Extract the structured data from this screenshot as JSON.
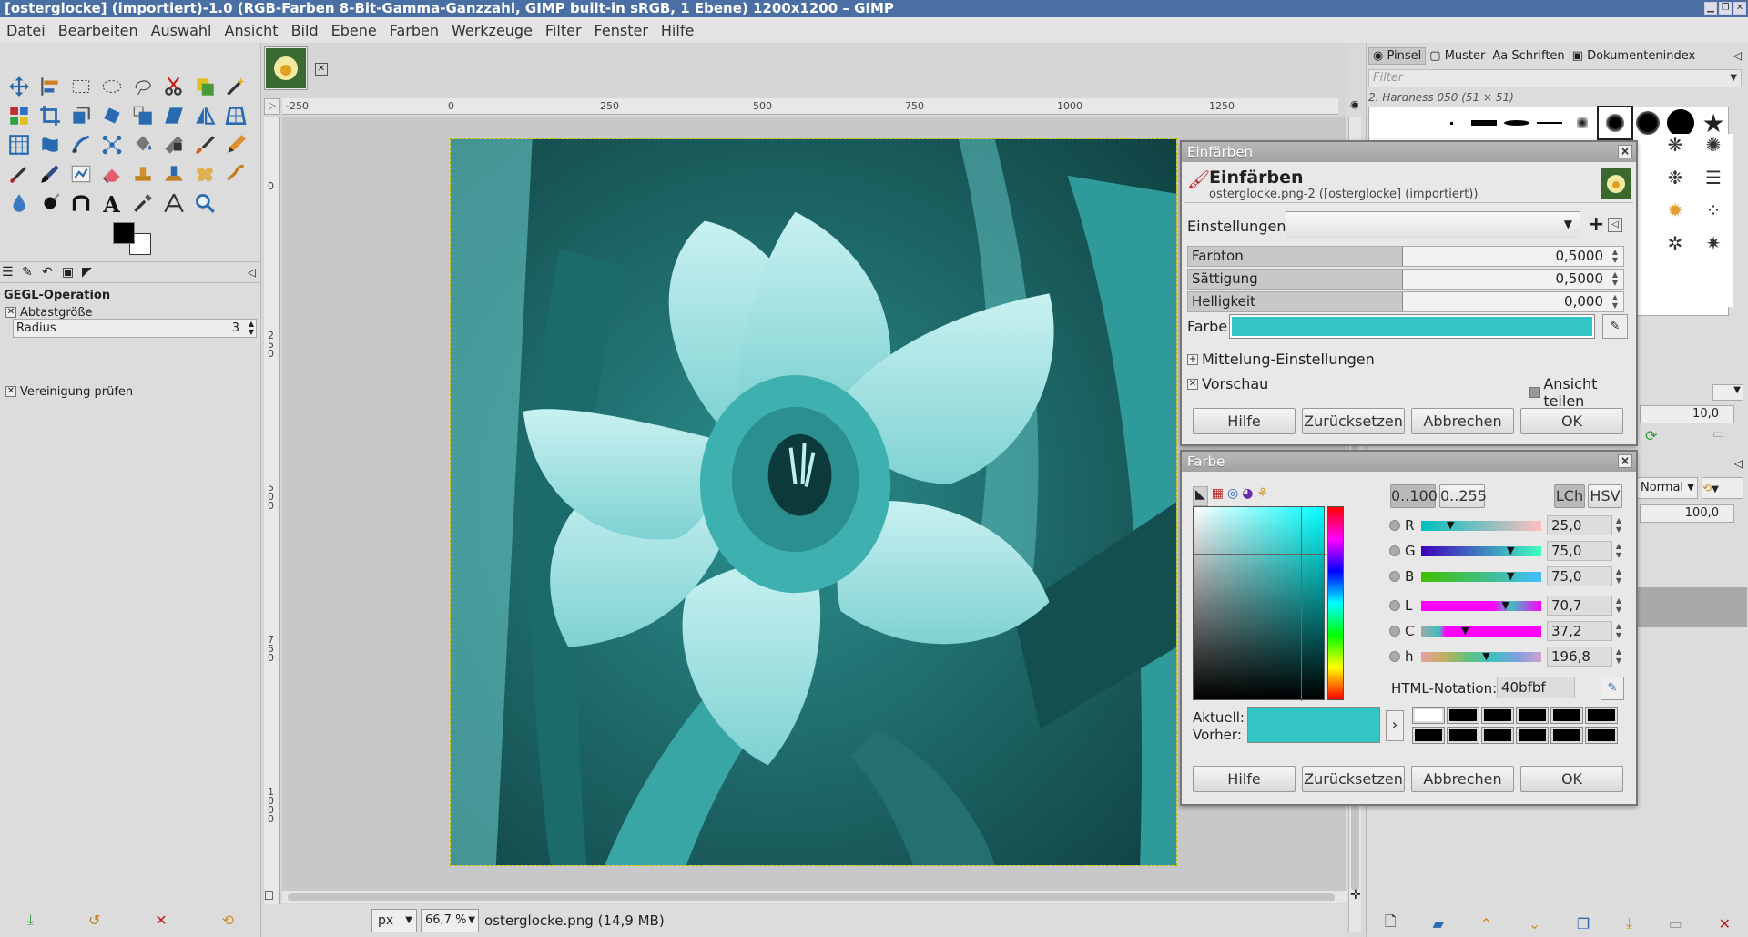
{
  "window": {
    "title": "[osterglocke] (importiert)-1.0 (RGB-Farben 8-Bit-Gamma-Ganzzahl, GIMP built-in sRGB, 1 Ebene) 1200x1200 – GIMP"
  },
  "menu": [
    "Datei",
    "Bearbeiten",
    "Auswahl",
    "Ansicht",
    "Bild",
    "Ebene",
    "Farben",
    "Werkzeuge",
    "Filter",
    "Fenster",
    "Hilfe"
  ],
  "tool_options": {
    "title": "GEGL-Operation",
    "sample_size_label": "Abtastgröße",
    "radius_label": "Radius",
    "radius_value": "3",
    "merge_label": "Vereinigung prüfen"
  },
  "ruler": {
    "h": [
      "-250",
      "0",
      "250",
      "500",
      "750",
      "1000",
      "1250"
    ],
    "v": [
      "0",
      "2 5 0",
      "5 0 0",
      "7 5 0",
      "1 0 0 0"
    ]
  },
  "status": {
    "unit": "px",
    "zoom": "66,7 %",
    "file": "osterglocke.png (14,9 MB)"
  },
  "brushes": {
    "tabs": [
      "Pinsel",
      "Muster",
      "Schriften",
      "Dokumentenindex"
    ],
    "filter_placeholder": "Filter",
    "current": "2. Hardness 050 (51 × 51)",
    "spacing": "10,0"
  },
  "layers": {
    "mode": "Normal",
    "opacity": "100,0"
  },
  "colorize": {
    "window_title": "Einfärben",
    "heading": "Einfärben",
    "subtitle": "osterglocke.png-2 ([osterglocke] (importiert))",
    "settings_label": "Einstellungen:",
    "hue_label": "Farbton",
    "hue_value": "0,5000",
    "sat_label": "Sättigung",
    "sat_value": "0,5000",
    "light_label": "Helligkeit",
    "light_value": "0,000",
    "color_label": "Farbe",
    "blending_label": "Mittelung-Einstellungen",
    "preview_label": "Vorschau",
    "split_label": "Ansicht teilen",
    "help": "Hilfe",
    "reset": "Zurücksetzen",
    "cancel": "Abbrechen",
    "ok": "OK"
  },
  "color_dialog": {
    "window_title": "Farbe",
    "range1": "0..100",
    "range2": "0..255",
    "lch": "LCh",
    "hsv": "HSV",
    "channels": [
      {
        "label": "R",
        "value": "25,0"
      },
      {
        "label": "G",
        "value": "75,0"
      },
      {
        "label": "B",
        "value": "75,0"
      },
      {
        "label": "L",
        "value": "70,7"
      },
      {
        "label": "C",
        "value": "37,2"
      },
      {
        "label": "h",
        "value": "196,8"
      }
    ],
    "channel_levels": [
      25,
      75,
      75,
      70.7,
      37.2,
      54.7
    ],
    "html_label": "HTML-Notation:",
    "html_value": "40bfbf",
    "current_label": "Aktuell:",
    "previous_label": "Vorher:",
    "help": "Hilfe",
    "reset": "Zurücksetzen",
    "cancel": "Abbrechen",
    "ok": "OK"
  },
  "colors": {
    "selected": "#40bfbf",
    "swatch_color": "#33c4c4",
    "titlebar": "#4a6fa5"
  }
}
